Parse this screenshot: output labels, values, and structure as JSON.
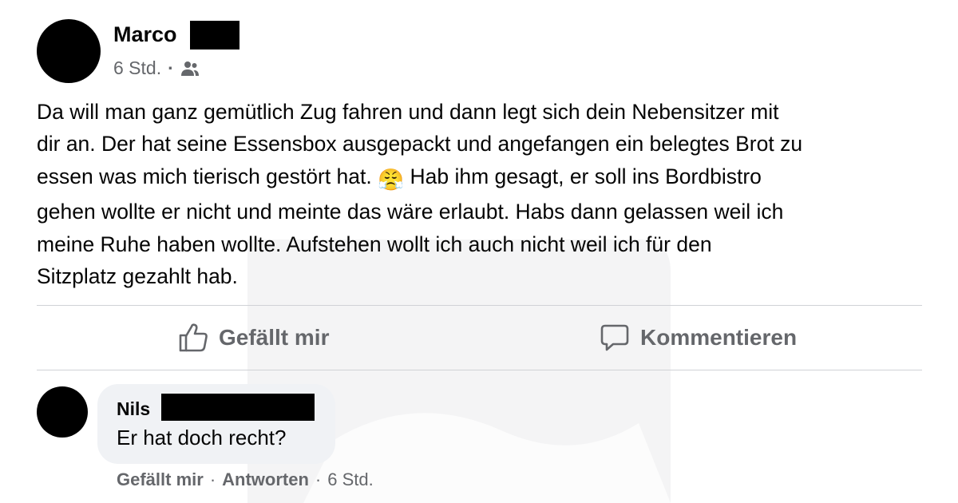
{
  "post": {
    "author": "Marco",
    "time": "6 Std.",
    "separator": "·",
    "audience_icon": "friends-icon",
    "text_parts": [
      "Da will man ganz gemütlich Zug fahren und dann legt sich dein Nebensitzer mit\ndir an. Der hat seine Essensbox ausgepackt und angefangen ein belegtes Brot zu\nessen was mich tierisch gestört hat. ",
      " Hab ihm gesagt, er soll ins Bordbistro\ngehen wollte er nicht und meinte das wäre erlaubt. Habs dann gelassen weil ich\nmeine Ruhe haben wollte. Aufstehen wollt ich auch nicht weil ich für den\nSitzplatz gezahlt hab."
    ],
    "emoji": "😤",
    "emoji_name": "face-with-steam-from-nose"
  },
  "actions": {
    "like_label": "Gefällt mir",
    "comment_label": "Kommentieren"
  },
  "comment": {
    "author": "Nils",
    "text": "Er hat doch recht?",
    "like_label": "Gefällt mir",
    "separator": "·",
    "reply_label": "Antworten",
    "time": "6 Std."
  },
  "colors": {
    "text": "#050505",
    "secondary": "#65676b",
    "bubble": "#f0f2f5",
    "divider": "#d0d2d6"
  }
}
